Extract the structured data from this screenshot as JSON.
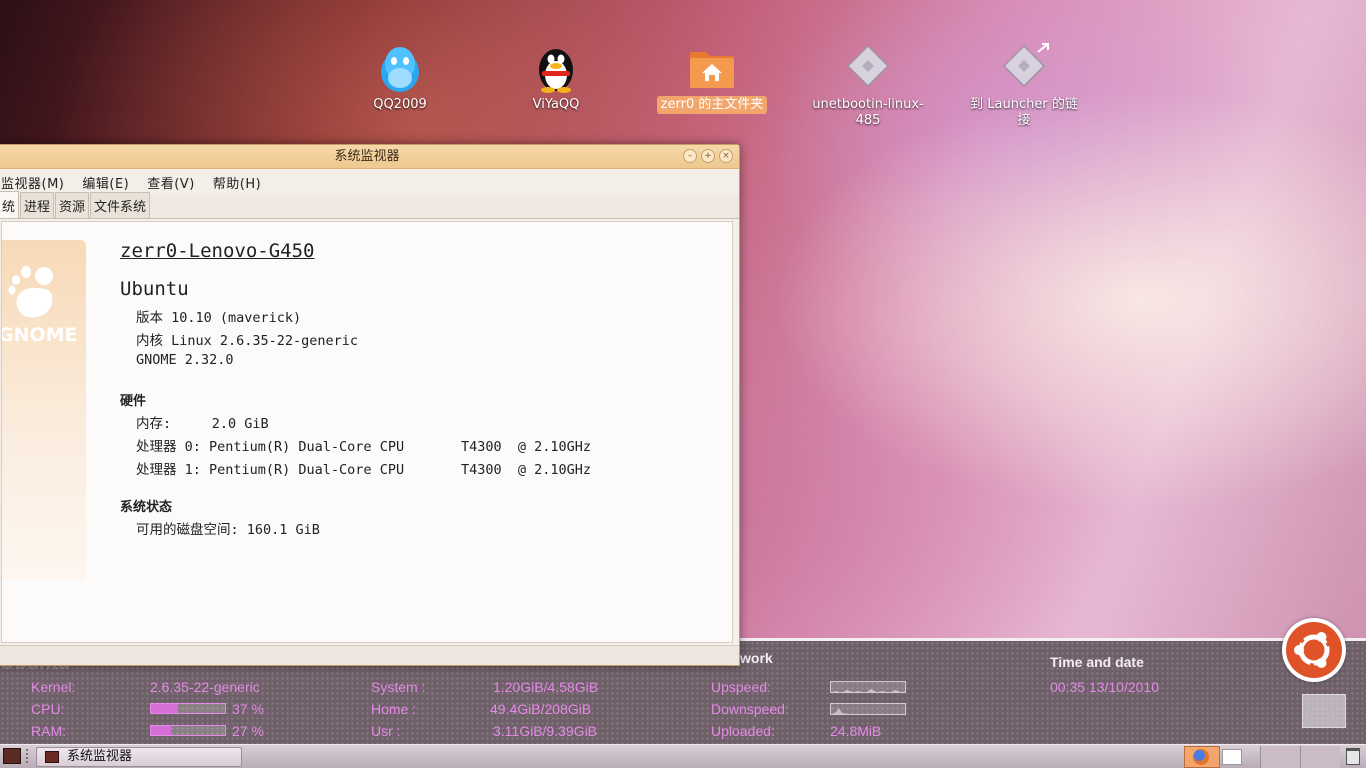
{
  "desktop": {
    "icons": [
      {
        "label": "QQ2009",
        "icon": "qq-penguin-blue-icon"
      },
      {
        "label": "ViYaQQ",
        "icon": "qq-penguin-icon"
      },
      {
        "label": "zerr0 的主文件夹",
        "icon": "home-folder-icon"
      },
      {
        "label": "unetbootin-linux-485",
        "label_line1": "unetbootin-linux-",
        "label_line2": "485",
        "icon": "executable-file-icon"
      },
      {
        "label": "到 Launcher 的链接",
        "icon": "link-file-icon"
      }
    ]
  },
  "window": {
    "title": "系统监视器",
    "menu": [
      "监视器(M)",
      "编辑(E)",
      "查看(V)",
      "帮助(H)"
    ],
    "tabs": [
      "统",
      "进程",
      "资源",
      "文件系统"
    ],
    "logo_text": "GNOME",
    "hostname": "zerr0-Lenovo-G450",
    "distro": "Ubuntu",
    "version_line": "版本 10.10 (maverick)",
    "kernel_line": "内核 Linux 2.6.35-22-generic",
    "gnome_line": "GNOME 2.32.0",
    "hardware_heading": "硬件",
    "memory_line": "内存:     2.0 GiB",
    "cpu0_line": "处理器 0: Pentium(R) Dual-Core CPU       T4300  @ 2.10GHz",
    "cpu1_line": "处理器 1: Pentium(R) Dual-Core CPU       T4300  @ 2.10GHz",
    "status_heading": "系统状态",
    "disk_line": "可用的磁盘空间: 160.1 GiB"
  },
  "conky": {
    "ghost_text": "Ubuntu",
    "network_header": "work",
    "time_header": "Time and date",
    "kernel_label": "Kernel:",
    "kernel_value": "2.6.35-22-generic",
    "cpu_label": "CPU:",
    "cpu_value": "37 %",
    "cpu_percent": 37,
    "ram_label": "RAM:",
    "ram_value": "27 %",
    "ram_percent": 27,
    "system_label": "System :",
    "system_value": "1.20GiB/4.58GiB",
    "home_label": "Home :",
    "home_value": "49.4GiB/208GiB",
    "usr_label": "Usr :",
    "usr_value": "3.11GiB/9.39GiB",
    "upspeed_label": "Upspeed:",
    "downspeed_label": "Downspeed:",
    "uploaded_label": "Uploaded:",
    "uploaded_value": "24.8MiB",
    "time_value": "00:35  13/10/2010"
  },
  "panel": {
    "task_label": "系统监视器"
  },
  "colors": {
    "conky_text": "#e58ae8",
    "ubuntu_orange": "#e05228"
  }
}
